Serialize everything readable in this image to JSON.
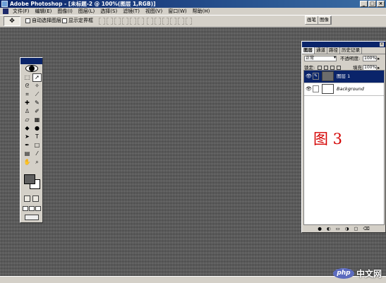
{
  "window": {
    "title": "Adobe Photoshop - [未标题-2 @ 100%(图层 1,RGB)]",
    "controls": [
      "_",
      "□",
      "×"
    ]
  },
  "menubar": {
    "items": [
      "文件(F)",
      "编辑(E)",
      "图像(I)",
      "图层(L)",
      "选择(S)",
      "滤镜(T)",
      "视图(V)",
      "窗口(W)",
      "帮助(H)"
    ]
  },
  "options_bar": {
    "tool_preset_icon": "move-tool-icon",
    "auto_select_label": "自动选择图层",
    "show_bounds_label": "显示定界框",
    "palette_well_tabs": [
      "画笔",
      "图像"
    ]
  },
  "toolbox": {
    "tools": [
      "marquee",
      "move",
      "lasso",
      "magic-wand",
      "crop",
      "slice",
      "healing-brush",
      "brush",
      "clone-stamp",
      "history-brush",
      "eraser",
      "gradient",
      "blur",
      "dodge",
      "path-select",
      "type",
      "pen",
      "shape",
      "notes",
      "eyedropper",
      "hand",
      "zoom"
    ],
    "foreground_color": "#5e5e5e",
    "background_color": "#ffffff"
  },
  "layers_panel": {
    "tabs": [
      "图层",
      "通道",
      "路径",
      "历史记录"
    ],
    "blend_mode": "正常",
    "opacity_label": "不透明度:",
    "opacity_value": "100%",
    "lock_label": "锁定:",
    "fill_label": "填充:",
    "fill_value": "100%",
    "layers": [
      {
        "name": "图层 1",
        "selected": true,
        "thumb_color": "#6c6c6c"
      },
      {
        "name": "Background",
        "selected": false,
        "thumb_color": "#ffffff"
      }
    ],
    "footer_icons": [
      "●",
      "◐",
      "▭",
      "◑",
      "▢",
      "⌫"
    ]
  },
  "figure_label": "图 3",
  "watermark": {
    "logo": "php",
    "text": "中文网"
  }
}
